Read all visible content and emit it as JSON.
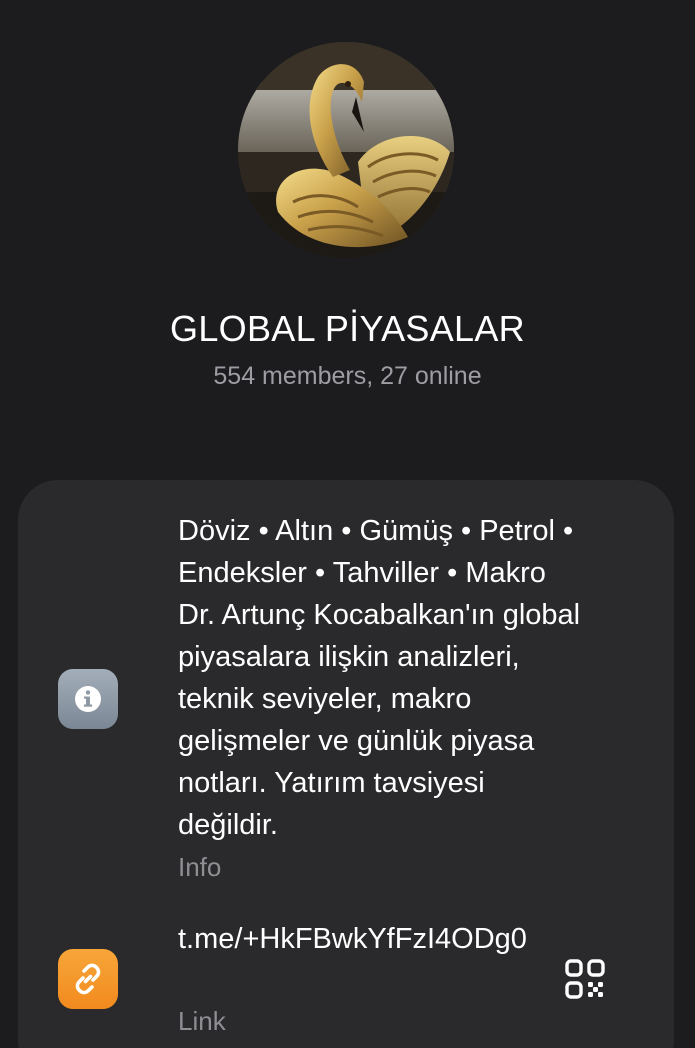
{
  "group": {
    "name": "GLOBAL PİYASALAR",
    "status": "554 members, 27 online"
  },
  "info": {
    "description": "Döviz • Altın • Gümüş • Petrol •\nEndeksler • Tahviller • Makro\nDr. Artunç Kocabalkan'ın global\npiyasalara ilişkin analizleri,\nteknik seviyeler, makro\ngelişmeler ve günlük piyasa\nnotları.  Yatırım tavsiyesi\ndeğildir.",
    "caption": "Info",
    "icon": "info-icon"
  },
  "link": {
    "url": "t.me/+HkFBwkYfFzI4ODg0",
    "caption": "Link",
    "icon": "link-icon",
    "qr_icon": "qr-code-icon"
  },
  "colors": {
    "background": "#1c1c1e",
    "card": "#2a2a2c",
    "secondary_text": "#8e8e93",
    "info_icon_bg": "#8e99a5",
    "link_icon_bg": "#f5992b"
  }
}
